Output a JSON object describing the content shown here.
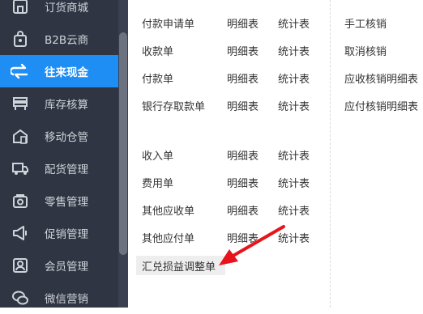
{
  "sidebar": {
    "items": [
      {
        "label": "订货商城",
        "icon": "store-icon",
        "active": false
      },
      {
        "label": "B2B云商",
        "icon": "shopping-bag-icon",
        "active": false
      },
      {
        "label": "往来现金",
        "icon": "exchange-arrows-icon",
        "active": true
      },
      {
        "label": "库存核算",
        "icon": "inventory-icon",
        "active": false
      },
      {
        "label": "移动仓管",
        "icon": "mobile-warehouse-icon",
        "active": false
      },
      {
        "label": "配货管理",
        "icon": "delivery-truck-icon",
        "active": false
      },
      {
        "label": "零售管理",
        "icon": "retail-icon",
        "active": false
      },
      {
        "label": "促销管理",
        "icon": "megaphone-icon",
        "active": false
      },
      {
        "label": "会员管理",
        "icon": "member-icon",
        "active": false
      },
      {
        "label": "微信营销",
        "icon": "wechat-icon",
        "active": false
      }
    ]
  },
  "menu": {
    "group1": [
      {
        "name": "付款申请单",
        "detail": "明细表",
        "stats": "统计表"
      },
      {
        "name": "收款单",
        "detail": "明细表",
        "stats": "统计表"
      },
      {
        "name": "付款单",
        "detail": "明细表",
        "stats": "统计表"
      },
      {
        "name": "银行存取款单",
        "detail": "明细表",
        "stats": "统计表"
      }
    ],
    "group2": [
      {
        "name": "收入单",
        "detail": "明细表",
        "stats": "统计表"
      },
      {
        "name": "费用单",
        "detail": "明细表",
        "stats": "统计表"
      },
      {
        "name": "其他应收单",
        "detail": "明细表",
        "stats": "统计表"
      },
      {
        "name": "其他应付单",
        "detail": "明细表",
        "stats": "统计表"
      }
    ],
    "highlighted_item": "汇兑损益调整单",
    "right_column": [
      "手工核销",
      "取消核销",
      "应收核销明细表",
      "应付核销明细表"
    ]
  },
  "colors": {
    "sidebar_bg": "#2f3542",
    "active_bg": "#1e8df4",
    "arrow": "#e8141b"
  }
}
